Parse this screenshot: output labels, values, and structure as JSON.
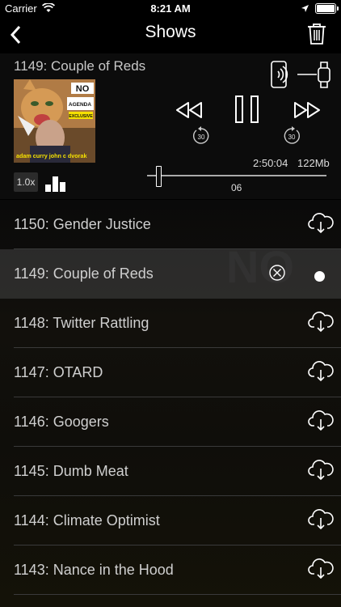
{
  "status_bar": {
    "carrier": "Carrier",
    "time": "8:21 AM"
  },
  "nav": {
    "title": "Shows"
  },
  "player": {
    "episode_title": "1149: Couple of Reds",
    "art": {
      "line1": "NO",
      "line2": "AGENDA",
      "line3": "EXCLUSIVE",
      "credits": "adam curry  john c dvorak"
    },
    "speed": "1.0x",
    "elapsed": "2:50:04",
    "size": "122Mb",
    "chapter": "06",
    "skip_back": "30",
    "skip_forward": "30",
    "progress": 0.06
  },
  "episodes": [
    {
      "label": "1150: Gender Justice",
      "state": "cloud"
    },
    {
      "label": "1149: Couple of Reds",
      "state": "active"
    },
    {
      "label": "1148: Twitter Rattling",
      "state": "cloud"
    },
    {
      "label": "1147: OTARD",
      "state": "cloud"
    },
    {
      "label": "1146: Googers",
      "state": "cloud"
    },
    {
      "label": "1145: Dumb Meat",
      "state": "cloud"
    },
    {
      "label": "1144: Climate Optimist",
      "state": "cloud"
    },
    {
      "label": "1143: Nance in the Hood",
      "state": "cloud"
    }
  ],
  "icons": {
    "back": "chevron-left-icon",
    "trash": "trash-icon",
    "device": "phone-to-watch-icon",
    "rewind": "rewind-icon",
    "pause": "pause-icon",
    "ffwd": "fast-forward-icon",
    "cloud": "cloud-download-icon",
    "delete": "circle-x-icon",
    "playing": "dot-icon"
  },
  "colors": {
    "background": "#000000",
    "row_active": "#505050",
    "text": "#cfcfcf"
  }
}
